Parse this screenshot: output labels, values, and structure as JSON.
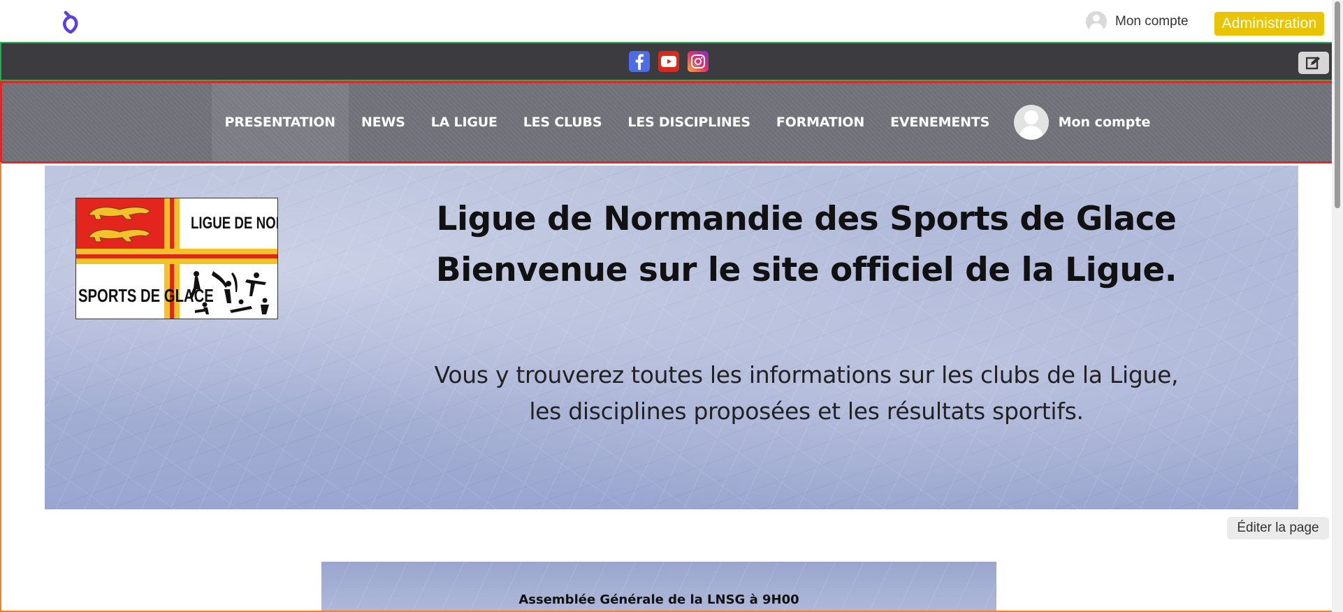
{
  "topbar": {
    "account_label": "Mon compte",
    "admin_label": "Administration",
    "admin_color": "#e8c500"
  },
  "social": {
    "icons": [
      "facebook-icon",
      "youtube-icon",
      "instagram-icon"
    ],
    "edit_icon": "edit-icon",
    "border_color": "#22b14c"
  },
  "nav": {
    "items": [
      {
        "label": "PRESENTATION"
      },
      {
        "label": "NEWS"
      },
      {
        "label": "LA LIGUE"
      },
      {
        "label": "LES CLUBS"
      },
      {
        "label": "LES DISCIPLINES"
      },
      {
        "label": "FORMATION"
      },
      {
        "label": "EVENEMENTS"
      }
    ],
    "account_label": "Mon compte",
    "border_color": "#e0262b"
  },
  "hero": {
    "logo_text_top": "LIGUE DE NORMANDIE",
    "logo_text_bottom": "SPORTS DE GLACE",
    "title_line1": "Ligue de Normandie des Sports de Glace",
    "title_line2": "Bienvenue sur le site officiel de la Ligue.",
    "subtitle_line1": "Vous y trouverez toutes les informations sur les clubs de la Ligue,",
    "subtitle_line2": "les disciplines proposées et les résultats sportifs."
  },
  "content": {
    "edit_page_label": "Éditer la page",
    "card_title": "Assemblée Générale de la LNSG à 9H00",
    "border_color": "#f0812c"
  }
}
